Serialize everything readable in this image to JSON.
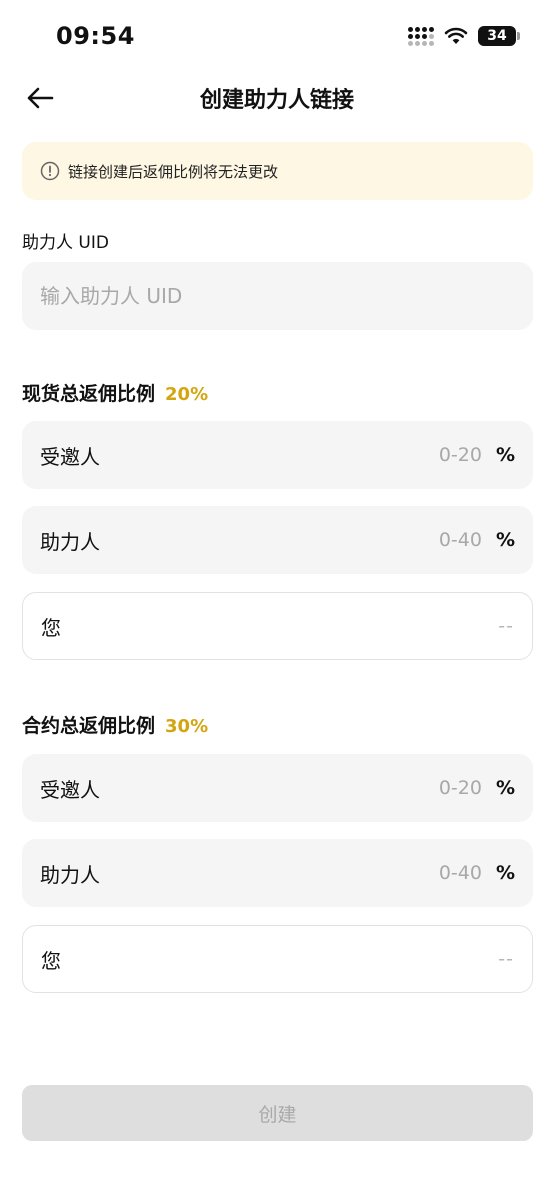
{
  "status_bar": {
    "time": "09:54",
    "battery": "34"
  },
  "header": {
    "title": "创建助力人链接"
  },
  "notice": {
    "text": "链接创建后返佣比例将无法更改"
  },
  "uid": {
    "label": "助力人 UID",
    "placeholder": "输入助力人 UID"
  },
  "spot": {
    "title": "现货总返佣比例",
    "percent": "20%",
    "rows": [
      {
        "label": "受邀人",
        "range": "0-20",
        "unit": "%"
      },
      {
        "label": "助力人",
        "range": "0-40",
        "unit": "%"
      },
      {
        "label": "您",
        "value": "--"
      }
    ]
  },
  "contract": {
    "title": "合约总返佣比例",
    "percent": "30%",
    "rows": [
      {
        "label": "受邀人",
        "range": "0-20",
        "unit": "%"
      },
      {
        "label": "助力人",
        "range": "0-40",
        "unit": "%"
      },
      {
        "label": "您",
        "value": "--"
      }
    ]
  },
  "button": {
    "label": "创建"
  },
  "colors": {
    "accent": "#d4a50f",
    "notice_bg": "#fdf7e3",
    "field_bg": "#f5f5f5",
    "button_disabled": "#dedede"
  }
}
